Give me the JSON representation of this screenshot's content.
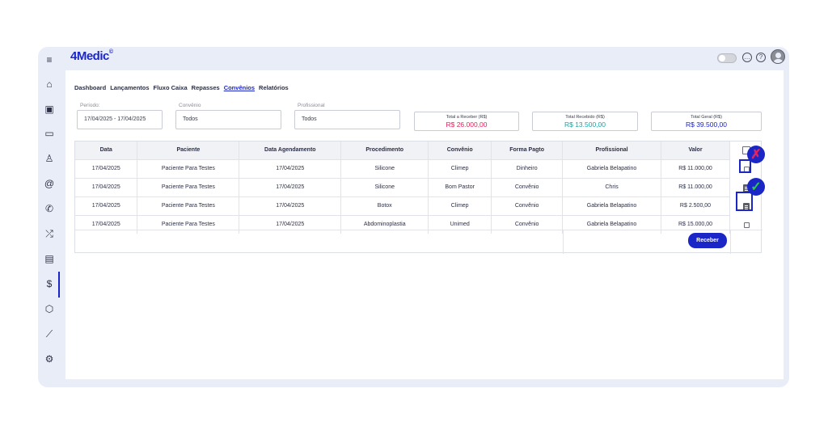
{
  "app": {
    "logo": "4Medic",
    "logo_mark": "©"
  },
  "sidebar": {
    "icons": [
      "menu-icon",
      "home-icon",
      "calendar-icon",
      "inbox-icon",
      "user-icon",
      "at-icon",
      "phone-icon",
      "shuffle-icon",
      "clipboard-icon",
      "dollar-icon",
      "box-icon",
      "chart-icon",
      "gear-icon"
    ],
    "glyphs": [
      "≡",
      "⌂",
      "▣",
      "▭",
      "♙",
      "@",
      "✆",
      "⤮",
      "▤",
      "$",
      "⬡",
      "⟋",
      "⚙"
    ]
  },
  "tabs": [
    "Dashboard",
    "Lançamentos",
    "Fluxo Caixa",
    "Repasses",
    "Convênios",
    "Relatórios"
  ],
  "active_tab": "Convênios",
  "filters": {
    "periodo": {
      "label": "Período:",
      "value": "17/04/2025 - 17/04/2025"
    },
    "convenio": {
      "label": "Convênio",
      "value": "Todos"
    },
    "profissional": {
      "label": "Profissional",
      "value": "Todos"
    }
  },
  "totals": [
    {
      "label": "Total a Receber (R$)",
      "value": "R$ 26.000,00",
      "color": "#e0245e"
    },
    {
      "label": "Total Recebido (R$)",
      "value": "R$ 13.500,00",
      "color": "#1aa3a3"
    },
    {
      "label": "Total Geral (R$)",
      "value": "R$ 39.500,00",
      "color": "#1b26c6"
    }
  ],
  "table": {
    "headers": [
      "Data",
      "Paciente",
      "Data Agendamento",
      "Procedimento",
      "Convênio",
      "Forma Pagto",
      "Profissional",
      "Valor"
    ],
    "rows": [
      [
        "17/04/2025",
        "Paciente Para Testes",
        "17/04/2025",
        "Silicone",
        "Climep",
        "Dinheiro",
        "Gabriela Belapatino",
        "R$ 11.000,00"
      ],
      [
        "17/04/2025",
        "Paciente Para Testes",
        "17/04/2025",
        "Silicone",
        "Bom Pastor",
        "Convênio",
        "Chris",
        "R$ 11.000,00"
      ],
      [
        "17/04/2025",
        "Paciente Para Testes",
        "17/04/2025",
        "Botox",
        "Climep",
        "Convênio",
        "Gabriela Belapatino",
        "R$ 2.500,00"
      ],
      [
        "17/04/2025",
        "Paciente Para Testes",
        "17/04/2025",
        "Abdominoplastia",
        "Unimed",
        "Convênio",
        "Gabriela Belapatino",
        "R$ 15.000,00"
      ]
    ],
    "row_states": [
      "checkbox",
      "receipt",
      "receipt",
      "checkbox"
    ]
  },
  "receber_label": "Receber",
  "annotations": {
    "cross": "✗",
    "check": "✓",
    "cross_color": "#e0245e",
    "check_color": "#2ecc40"
  }
}
